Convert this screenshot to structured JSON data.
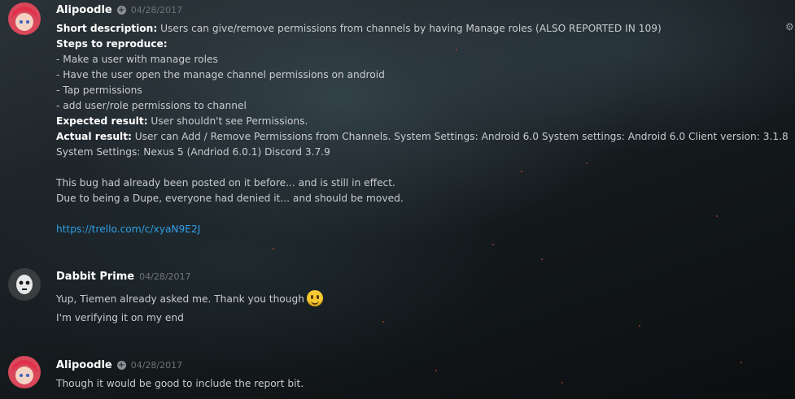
{
  "messages": [
    {
      "author": "Alipoodle",
      "timestamp": "04/28/2017",
      "lines": {
        "l1_label": "Short description:",
        "l1_text": " Users can give/remove permissions from channels by having Manage roles (ALSO REPORTED IN 109)",
        "l2_label": "Steps to reproduce:",
        "l3": "- Make a user with manage roles",
        "l4": "- Have the user open the manage channel permissions on android",
        "l5": "- Tap permissions",
        "l6": "- add user/role permissions to channel",
        "l7_label": "Expected result:",
        "l7_text": "  User shouldn't see Permissions.",
        "l8_label": "Actual result:",
        "l8_text": "  User can Add / Remove Permissions from Channels. System Settings: Android 6.0 System settings: Android 6.0 Client version: 3.1.8",
        "l9": "System Settings: Nexus 5 (Andriod 6.0.1) Discord 3.7.9",
        "l10": "This bug had already been posted on it before... and is still in effect.",
        "l11": "Due to being a Dupe, everyone had denied it... and should be moved.",
        "link": "https://trello.com/c/xyaN9E2J"
      }
    },
    {
      "author": "Dabbit Prime",
      "timestamp": "04/28/2017",
      "lines": {
        "l1": "Yup, Tiemen already asked me. Thank you though",
        "l2": "I'm verifying it on my end"
      }
    },
    {
      "author": "Alipoodle",
      "timestamp": "04/28/2017",
      "lines": {
        "l1": "Though it would be good to include the report bit."
      }
    }
  ],
  "icons": {
    "role": "plus-circle-icon",
    "emoji": "smiley-emoji-icon",
    "settings": "gear-icon"
  },
  "colors": {
    "link": "#2f9ee6",
    "username": "#ffffff",
    "timestamp": "#6f7478"
  }
}
